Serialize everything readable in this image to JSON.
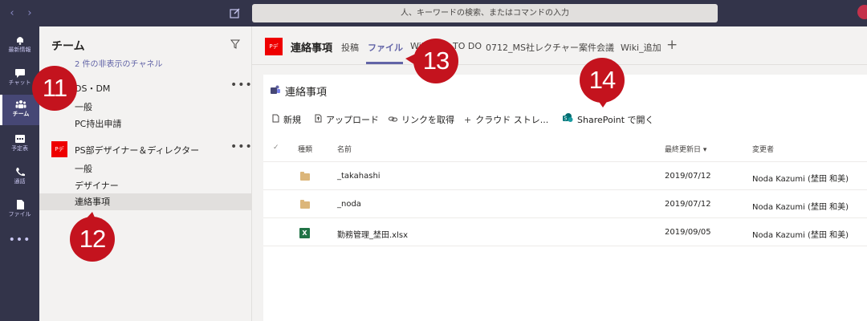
{
  "topbar": {
    "back": "‹",
    "forward": "›",
    "search_placeholder": "人、キーワードの検索、またはコマンドの入力"
  },
  "rail": {
    "items": [
      {
        "label": "最新情報",
        "icon": "bell-icon"
      },
      {
        "label": "チャット",
        "icon": "chat-icon"
      },
      {
        "label": "チーム",
        "icon": "teams-icon"
      },
      {
        "label": "予定表",
        "icon": "calendar-icon"
      },
      {
        "label": "通話",
        "icon": "phone-icon"
      },
      {
        "label": "ファイル",
        "icon": "file-icon"
      }
    ],
    "more": "•••"
  },
  "teams_panel": {
    "title": "チーム",
    "hidden_channels": "2 件の非表示のチャネル",
    "team1": {
      "name": "DS・DM",
      "more": "•••",
      "channels": [
        "一般",
        "PC持出申請"
      ]
    },
    "team2": {
      "name": "PS部デザイナー＆ディレクター",
      "logo": "Pデ",
      "more": "•••",
      "channels": [
        "一般",
        "デザイナー",
        "連絡事項"
      ]
    }
  },
  "main": {
    "logo": "Pデ",
    "title": "連絡事項",
    "tabs": [
      "投稿",
      "ファイル",
      "Wiki",
      "TO DO",
      "0712_MS社レクチャー",
      "案件会議",
      "Wiki_追加"
    ],
    "add_tab": "+",
    "files_title": "連絡事項",
    "commands": [
      "新規",
      "アップロード",
      "リンクを取得",
      "クラウド ストレ...",
      "SharePoint で開く"
    ],
    "columns": {
      "check": "✓",
      "type": "種類",
      "name": "名前",
      "modified": "最終更新日 ▾",
      "modified_by": "変更者"
    },
    "rows": [
      {
        "name": "_takahashi",
        "modified": "2019/07/12",
        "by": "Noda Kazumi (埜田 和美)"
      },
      {
        "name": "_noda",
        "modified": "2019/07/12",
        "by": "Noda Kazumi (埜田 和美)"
      },
      {
        "name": "勤務管理_埜田.xlsx",
        "modified": "2019/09/05",
        "by": "Noda Kazumi (埜田 和美)"
      }
    ]
  },
  "callouts": [
    "11",
    "12",
    "13",
    "14"
  ],
  "colors": {
    "accent": "#6264a7",
    "rail": "#33344a",
    "callout": "#c4131e",
    "team_logo": "#ee0000"
  }
}
